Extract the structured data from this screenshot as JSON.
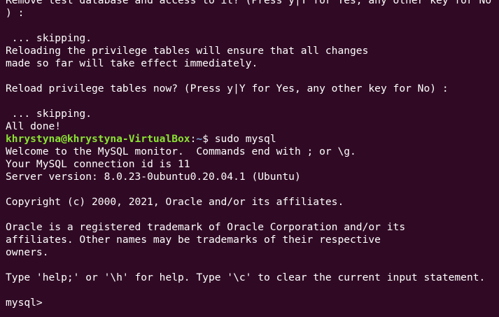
{
  "terminal": {
    "colors": {
      "background": "#300a24",
      "text": "#ffffff",
      "prompt_user": "#8ae234",
      "prompt_path": "#729fcf"
    },
    "lines": {
      "l01": "Remove test database and access to it? (Press y|Y for Yes, any other key for No",
      "l02": ") :",
      "l03": "",
      "l04": " ... skipping.",
      "l05": "Reloading the privilege tables will ensure that all changes",
      "l06": "made so far will take effect immediately.",
      "l07": "",
      "l08": "Reload privilege tables now? (Press y|Y for Yes, any other key for No) :",
      "l09": "",
      "l10": " ... skipping.",
      "l11": "All done!",
      "l13": "Welcome to the MySQL monitor.  Commands end with ; or \\g.",
      "l14": "Your MySQL connection id is 11",
      "l15": "Server version: 8.0.23-0ubuntu0.20.04.1 (Ubuntu)",
      "l16": "",
      "l17": "Copyright (c) 2000, 2021, Oracle and/or its affiliates.",
      "l18": "",
      "l19": "Oracle is a registered trademark of Oracle Corporation and/or its",
      "l20": "affiliates. Other names may be trademarks of their respective",
      "l21": "owners.",
      "l22": "",
      "l23": "Type 'help;' or '\\h' for help. Type '\\c' to clear the current input statement.",
      "l24": ""
    },
    "shell_prompt": {
      "user_host": "khrystyna@khrystyna-VirtualBox",
      "separator": ":",
      "path": "~",
      "symbol": "$ ",
      "command": "sudo mysql"
    },
    "mysql_prompt": "mysql> "
  }
}
